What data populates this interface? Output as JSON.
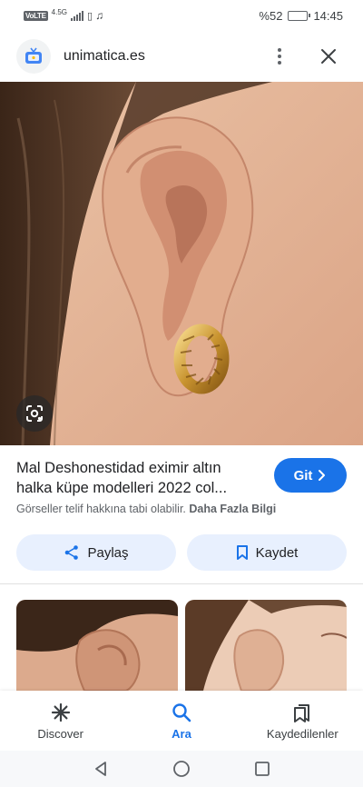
{
  "status_bar": {
    "volte": "VoLTE",
    "network": "4.5G",
    "battery": "%52",
    "battery_level": 0.52,
    "time": "14:45"
  },
  "source": {
    "domain": "unimatica.es",
    "favicon": "tv-icon",
    "more_icon": "more-vert-icon",
    "close_icon": "close-icon"
  },
  "image": {
    "lens_icon": "lens-icon"
  },
  "result": {
    "title": "Mal Deshonestidad eximir altın halka küpe modelleri 2022 col...",
    "go_label": "Git",
    "copyright_notice": "Görseller telif hakkına tabi olabilir.",
    "more_info_label": "Daha Fazla Bilgi"
  },
  "actions": {
    "share_label": "Paylaş",
    "save_label": "Kaydet"
  },
  "bottom_nav": {
    "items": [
      {
        "label": "Discover",
        "icon": "asterisk-icon",
        "active": false
      },
      {
        "label": "Ara",
        "icon": "search-icon",
        "active": true
      },
      {
        "label": "Kaydedilenler",
        "icon": "saved-icon",
        "active": false
      }
    ]
  },
  "colors": {
    "accent": "#1a73e8",
    "chip_bg": "#e8f0fe"
  }
}
